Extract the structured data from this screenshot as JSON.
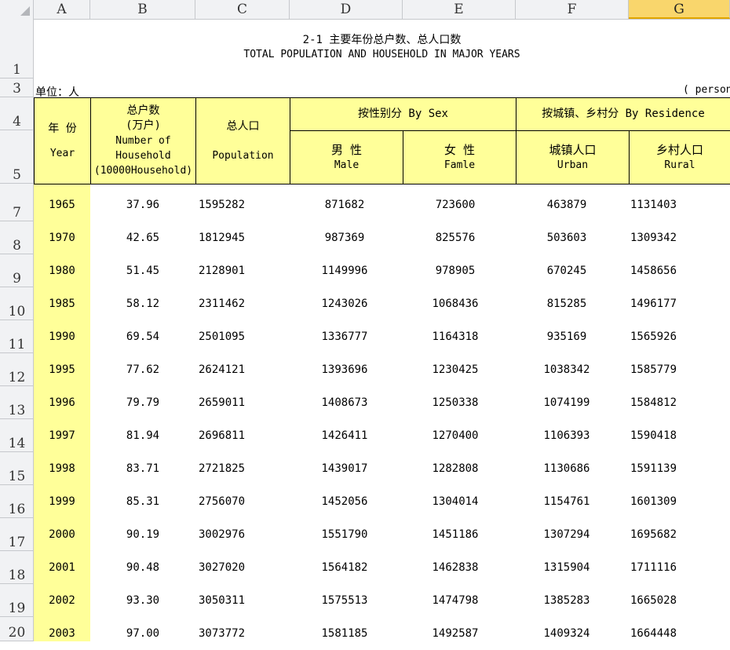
{
  "columns": [
    "A",
    "B",
    "C",
    "D",
    "E",
    "F",
    "G"
  ],
  "row_numbers": [
    "1",
    "3",
    "4",
    "5",
    "7",
    "8",
    "9",
    "10",
    "11",
    "12",
    "13",
    "14",
    "15",
    "16",
    "17",
    "18",
    "19",
    "20"
  ],
  "title_cn": "2-1  主要年份总户数、总人口数",
  "title_en": "TOTAL POPULATION AND HOUSEHOLD IN MAJOR YEARS",
  "unit_cn": "单位：人",
  "unit_en": "( person",
  "headers": {
    "year_cn": "年  份",
    "year_en": "Year",
    "household_cn": "总户数",
    "household_cn2": "(万户)",
    "household_en1": "Number of",
    "household_en2": "Household",
    "household_en3": "(10000Household)",
    "population_cn": "总人口",
    "population_en": "Population",
    "bysex": "按性别分  By Sex",
    "male_cn": "男    性",
    "male_en": "Male",
    "female_cn": "女    性",
    "female_en": "Famle",
    "byresidence": "按城镇、乡村分  By Residence",
    "urban_cn": "城镇人口",
    "urban_en": "Urban",
    "rural_cn": "乡村人口",
    "rural_en": "Rural"
  },
  "rows": [
    {
      "year": "1965",
      "household": "37.96",
      "population": "1595282",
      "male": "871682",
      "female": "723600",
      "urban": "463879",
      "rural": "1131403"
    },
    {
      "year": "1970",
      "household": "42.65",
      "population": "1812945",
      "male": "987369",
      "female": "825576",
      "urban": "503603",
      "rural": "1309342"
    },
    {
      "year": "1980",
      "household": "51.45",
      "population": "2128901",
      "male": "1149996",
      "female": "978905",
      "urban": "670245",
      "rural": "1458656"
    },
    {
      "year": "1985",
      "household": "58.12",
      "population": "2311462",
      "male": "1243026",
      "female": "1068436",
      "urban": "815285",
      "rural": "1496177"
    },
    {
      "year": "1990",
      "household": "69.54",
      "population": "2501095",
      "male": "1336777",
      "female": "1164318",
      "urban": "935169",
      "rural": "1565926"
    },
    {
      "year": "1995",
      "household": "77.62",
      "population": "2624121",
      "male": "1393696",
      "female": "1230425",
      "urban": "1038342",
      "rural": "1585779"
    },
    {
      "year": "1996",
      "household": "79.79",
      "population": "2659011",
      "male": "1408673",
      "female": "1250338",
      "urban": "1074199",
      "rural": "1584812"
    },
    {
      "year": "1997",
      "household": "81.94",
      "population": "2696811",
      "male": "1426411",
      "female": "1270400",
      "urban": "1106393",
      "rural": "1590418"
    },
    {
      "year": "1998",
      "household": "83.71",
      "population": "2721825",
      "male": "1439017",
      "female": "1282808",
      "urban": "1130686",
      "rural": "1591139"
    },
    {
      "year": "1999",
      "household": "85.31",
      "population": "2756070",
      "male": "1452056",
      "female": "1304014",
      "urban": "1154761",
      "rural": "1601309"
    },
    {
      "year": "2000",
      "household": "90.19",
      "population": "3002976",
      "male": "1551790",
      "female": "1451186",
      "urban": "1307294",
      "rural": "1695682"
    },
    {
      "year": "2001",
      "household": "90.48",
      "population": "3027020",
      "male": "1564182",
      "female": "1462838",
      "urban": "1315904",
      "rural": "1711116"
    },
    {
      "year": "2002",
      "household": "93.30",
      "population": "3050311",
      "male": "1575513",
      "female": "1474798",
      "urban": "1385283",
      "rural": "1665028"
    },
    {
      "year": "2003",
      "household": "97.00",
      "population": "3073772",
      "male": "1581185",
      "female": "1492587",
      "urban": "1409324",
      "rural": "1664448"
    }
  ],
  "selected_column": "G"
}
